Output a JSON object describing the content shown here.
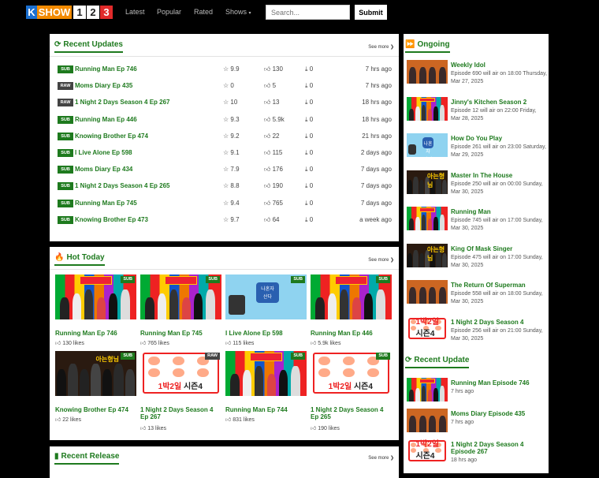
{
  "logo": {
    "k": "K",
    "show": "SHOW",
    "n1": "1",
    "n2": "2",
    "n3": "3"
  },
  "nav": {
    "latest": "Latest",
    "popular": "Popular",
    "rated": "Rated",
    "shows": "Shows"
  },
  "search": {
    "placeholder": "Search...",
    "submit": "Submit"
  },
  "recent_updates": {
    "title": "Recent Updates",
    "more": "See more",
    "rows": [
      {
        "badge": "SUB",
        "title": "Running Man Ep 746",
        "rating": "9.9",
        "likes": "130",
        "downloads": "0",
        "time": "7 hrs ago"
      },
      {
        "badge": "RAW",
        "title": "Moms Diary Ep 435",
        "rating": "0",
        "likes": "5",
        "downloads": "0",
        "time": "7 hrs ago"
      },
      {
        "badge": "RAW",
        "title": "1 Night 2 Days Season 4 Ep 267",
        "rating": "10",
        "likes": "13",
        "downloads": "0",
        "time": "18 hrs ago"
      },
      {
        "badge": "SUB",
        "title": "Running Man Ep 446",
        "rating": "9.3",
        "likes": "5.9k",
        "downloads": "0",
        "time": "18 hrs ago"
      },
      {
        "badge": "SUB",
        "title": "Knowing Brother Ep 474",
        "rating": "9.2",
        "likes": "22",
        "downloads": "0",
        "time": "21 hrs ago"
      },
      {
        "badge": "SUB",
        "title": "I Live Alone Ep 598",
        "rating": "9.1",
        "likes": "115",
        "downloads": "0",
        "time": "2 days ago"
      },
      {
        "badge": "SUB",
        "title": "Moms Diary Ep 434",
        "rating": "7.9",
        "likes": "176",
        "downloads": "0",
        "time": "7 days ago"
      },
      {
        "badge": "SUB",
        "title": "1 Night 2 Days Season 4 Ep 265",
        "rating": "8.8",
        "likes": "190",
        "downloads": "0",
        "time": "7 days ago"
      },
      {
        "badge": "SUB",
        "title": "Running Man Ep 745",
        "rating": "9.4",
        "likes": "765",
        "downloads": "0",
        "time": "7 days ago"
      },
      {
        "badge": "SUB",
        "title": "Knowing Brother Ep 473",
        "rating": "9.7",
        "likes": "64",
        "downloads": "0",
        "time": "a week ago"
      }
    ]
  },
  "hot_today": {
    "title": "Hot Today",
    "more": "See more",
    "cards": [
      {
        "badge": "SUB",
        "title": "Running Man Ep 746",
        "likes": "130 likes"
      },
      {
        "badge": "SUB",
        "title": "Running Man Ep 745",
        "likes": "765 likes"
      },
      {
        "badge": "SUB",
        "title": "I Live Alone Ep 598",
        "likes": "115 likes"
      },
      {
        "badge": "SUB",
        "title": "Running Man Ep 446",
        "likes": "5.9k likes"
      },
      {
        "badge": "SUB",
        "title": "Knowing Brother Ep 474",
        "likes": "22 likes"
      },
      {
        "badge": "RAW",
        "title": "1 Night 2 Days Season 4 Ep 267",
        "likes": "13 likes"
      },
      {
        "badge": "SUB",
        "title": "Running Man Ep 744",
        "likes": "831 likes"
      },
      {
        "badge": "SUB",
        "title": "1 Night 2 Days Season 4 Ep 265",
        "likes": "190 likes"
      }
    ]
  },
  "recent_release": {
    "title": "Recent Release",
    "more": "See more"
  },
  "ongoing": {
    "title": "Ongoing",
    "items": [
      {
        "title": "Weekly Idol",
        "desc": "Episode 690 will air on 18:00 Thursday, Mar 27, 2025"
      },
      {
        "title": "Jinny's Kitchen Season 2",
        "desc": "Episode 12 will air on 22:00 Friday, Mar 28, 2025"
      },
      {
        "title": "How Do You Play",
        "desc": "Episode 261 will air on 23:00 Saturday, Mar 29, 2025"
      },
      {
        "title": "Master In The House",
        "desc": "Episode 250 will air on 00:00 Sunday, Mar 30, 2025"
      },
      {
        "title": "Running Man",
        "desc": "Episode 745 will air on 17:00 Sunday, Mar 30, 2025"
      },
      {
        "title": "King Of Mask Singer",
        "desc": "Episode 475 will air on 17:00 Sunday, Mar 30, 2025"
      },
      {
        "title": "The Return Of Superman",
        "desc": "Episode 558 will air on 18:00 Sunday, Mar 30, 2025"
      },
      {
        "title": "1 Night 2 Days Season 4",
        "desc": "Episode 256 will air on 21:00 Sunday, Mar 30, 2025"
      }
    ]
  },
  "recent_update": {
    "title": "Recent Update",
    "items": [
      {
        "title": "Running Man Episode 746",
        "desc": "7 hrs ago"
      },
      {
        "title": "Moms Diary Episode 435",
        "desc": "7 hrs ago"
      },
      {
        "title": "1 Night 2 Days Season 4 Episode 267",
        "desc": "18 hrs ago"
      }
    ]
  },
  "thumb_text": {
    "sign1": "나혼자",
    "sign2": "산다",
    "show_a": "1박2일",
    "show_b": "시즌4",
    "show_c": "아는형님"
  }
}
